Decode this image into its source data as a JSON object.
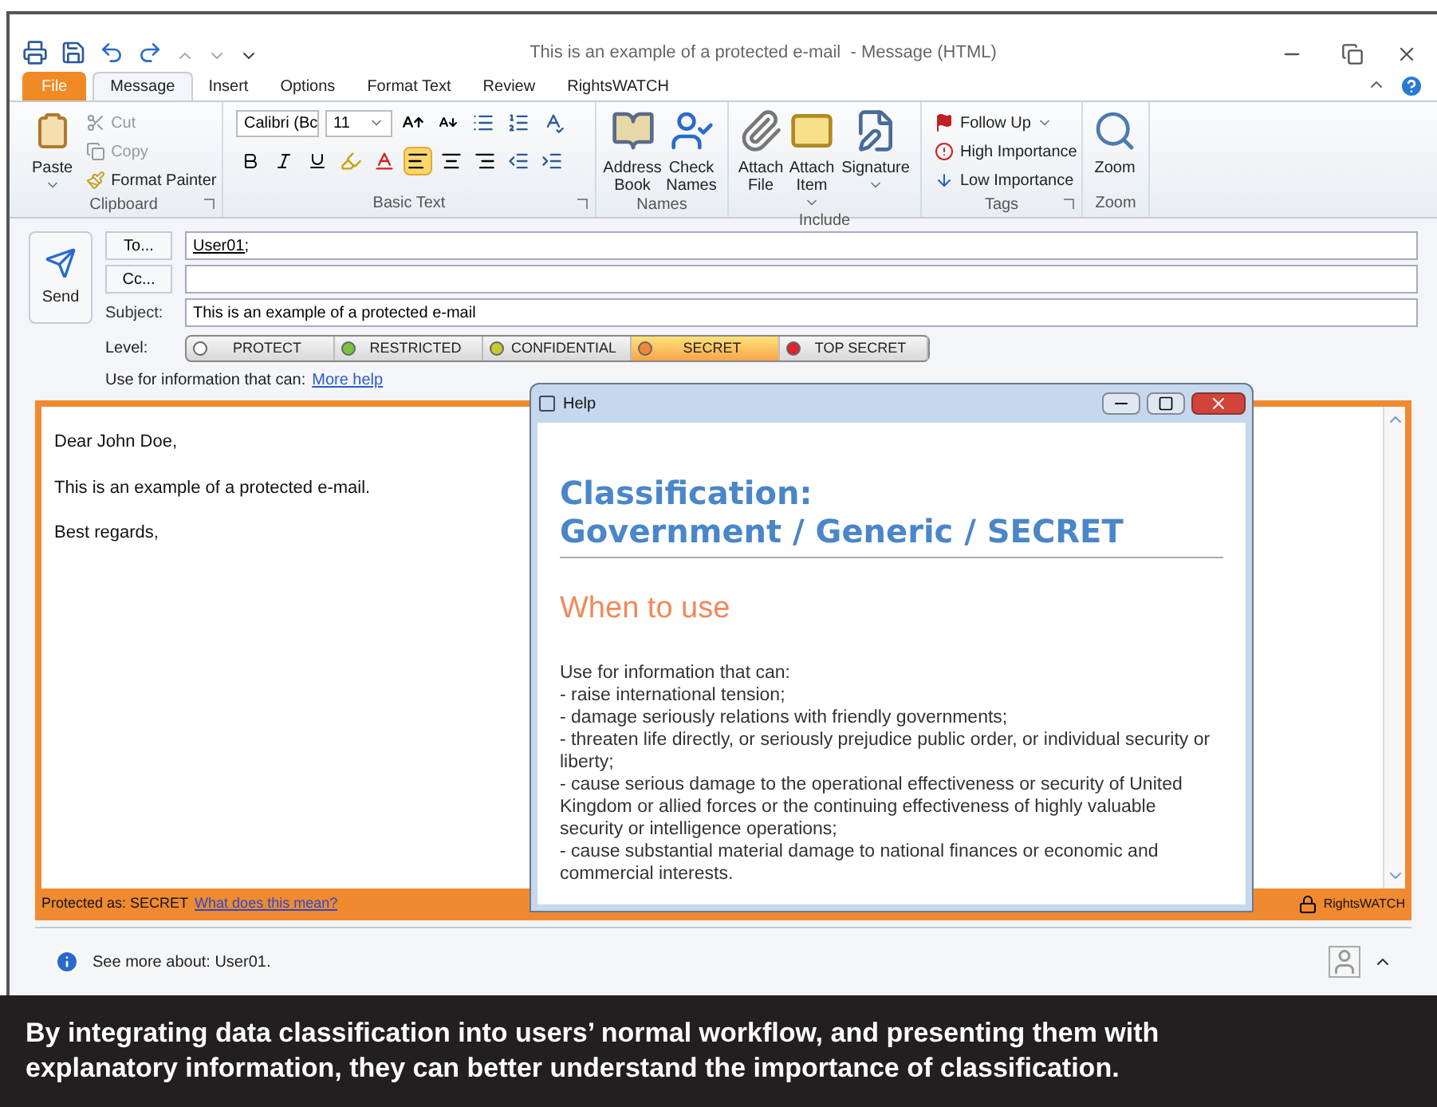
{
  "window": {
    "title": "This is an example of a protected e-mail  - Message (HTML)"
  },
  "tabs": [
    {
      "label": "File",
      "kind": "file",
      "selected": false
    },
    {
      "label": "Message",
      "kind": "tab",
      "selected": true
    },
    {
      "label": "Insert",
      "kind": "tab",
      "selected": false
    },
    {
      "label": "Options",
      "kind": "tab",
      "selected": false
    },
    {
      "label": "Format Text",
      "kind": "tab",
      "selected": false
    },
    {
      "label": "Review",
      "kind": "tab",
      "selected": false
    },
    {
      "label": "RightsWATCH",
      "kind": "tab",
      "selected": false
    }
  ],
  "ribbon": {
    "clipboard": {
      "label": "Clipboard",
      "paste": "Paste",
      "cut": {
        "label": "Cut",
        "disabled": true
      },
      "copy": {
        "label": "Copy",
        "disabled": true
      },
      "format_painter": {
        "label": "Format Painter",
        "disabled": false
      }
    },
    "basic_text": {
      "label": "Basic Text",
      "font": "Calibri (Bc",
      "size": "11",
      "alignment": [
        {
          "selected": true
        },
        {
          "selected": false
        },
        {
          "selected": false
        }
      ]
    },
    "names": {
      "label": "Names",
      "address_book": "Address Book",
      "check_names": "Check Names"
    },
    "include": {
      "label": "Include",
      "attach_file": "Attach File",
      "attach_item": "Attach Item",
      "signature": "Signature"
    },
    "tags": {
      "label": "Tags",
      "follow_up": "Follow Up",
      "high_importance": "High Importance",
      "low_importance": "Low Importance"
    },
    "zoom": {
      "label": "Zoom",
      "zoom": "Zoom"
    }
  },
  "compose": {
    "send": "Send",
    "to_button": "To...",
    "to_value": "User01;",
    "cc_button": "Cc...",
    "subject_label": "Subject:",
    "subject_value": "This is an example of a protected e-mail",
    "level_label": "Level:",
    "levels": [
      {
        "label": "PROTECT",
        "color": "#ffffff",
        "selected": false
      },
      {
        "label": "RESTRICTED",
        "color": "#7cc242",
        "selected": false
      },
      {
        "label": "CONFIDENTIAL",
        "color": "#c8c832",
        "selected": false
      },
      {
        "label": "SECRET",
        "color": "#f0883a",
        "selected": true
      },
      {
        "label": "TOP SECRET",
        "color": "#e0242c",
        "selected": false
      }
    ],
    "info_text": "Use for information that can:",
    "info_link": "More help"
  },
  "body": {
    "lines": [
      "Dear John Doe,",
      "This is an example of a protected e-mail.",
      "Best regards,"
    ],
    "protected_as": "Protected as: SECRET",
    "meaning_link": "What does this mean?",
    "brand": "RightsWATCH"
  },
  "help": {
    "title": "Help",
    "heading": [
      "Classification:",
      "Government / Generic / SECRET"
    ],
    "subheading": "When to use",
    "lines": [
      "Use for information that can:",
      "- raise international tension;",
      "- damage seriously relations with friendly governments;",
      "- threaten life directly, or seriously prejudice public order, or individual security or liberty;",
      "- cause serious damage to the operational effectiveness or security of United Kingdom or allied forces or the continuing effectiveness of highly valuable security or intelligence operations;",
      "- cause substantial material damage to national finances or economic and commercial interests."
    ]
  },
  "status_bar": {
    "text": "See more about: User01."
  },
  "caption": "By integrating data classification into users’ normal workflow, and presenting them with explanatory information, they can better understand the importance of classification."
}
